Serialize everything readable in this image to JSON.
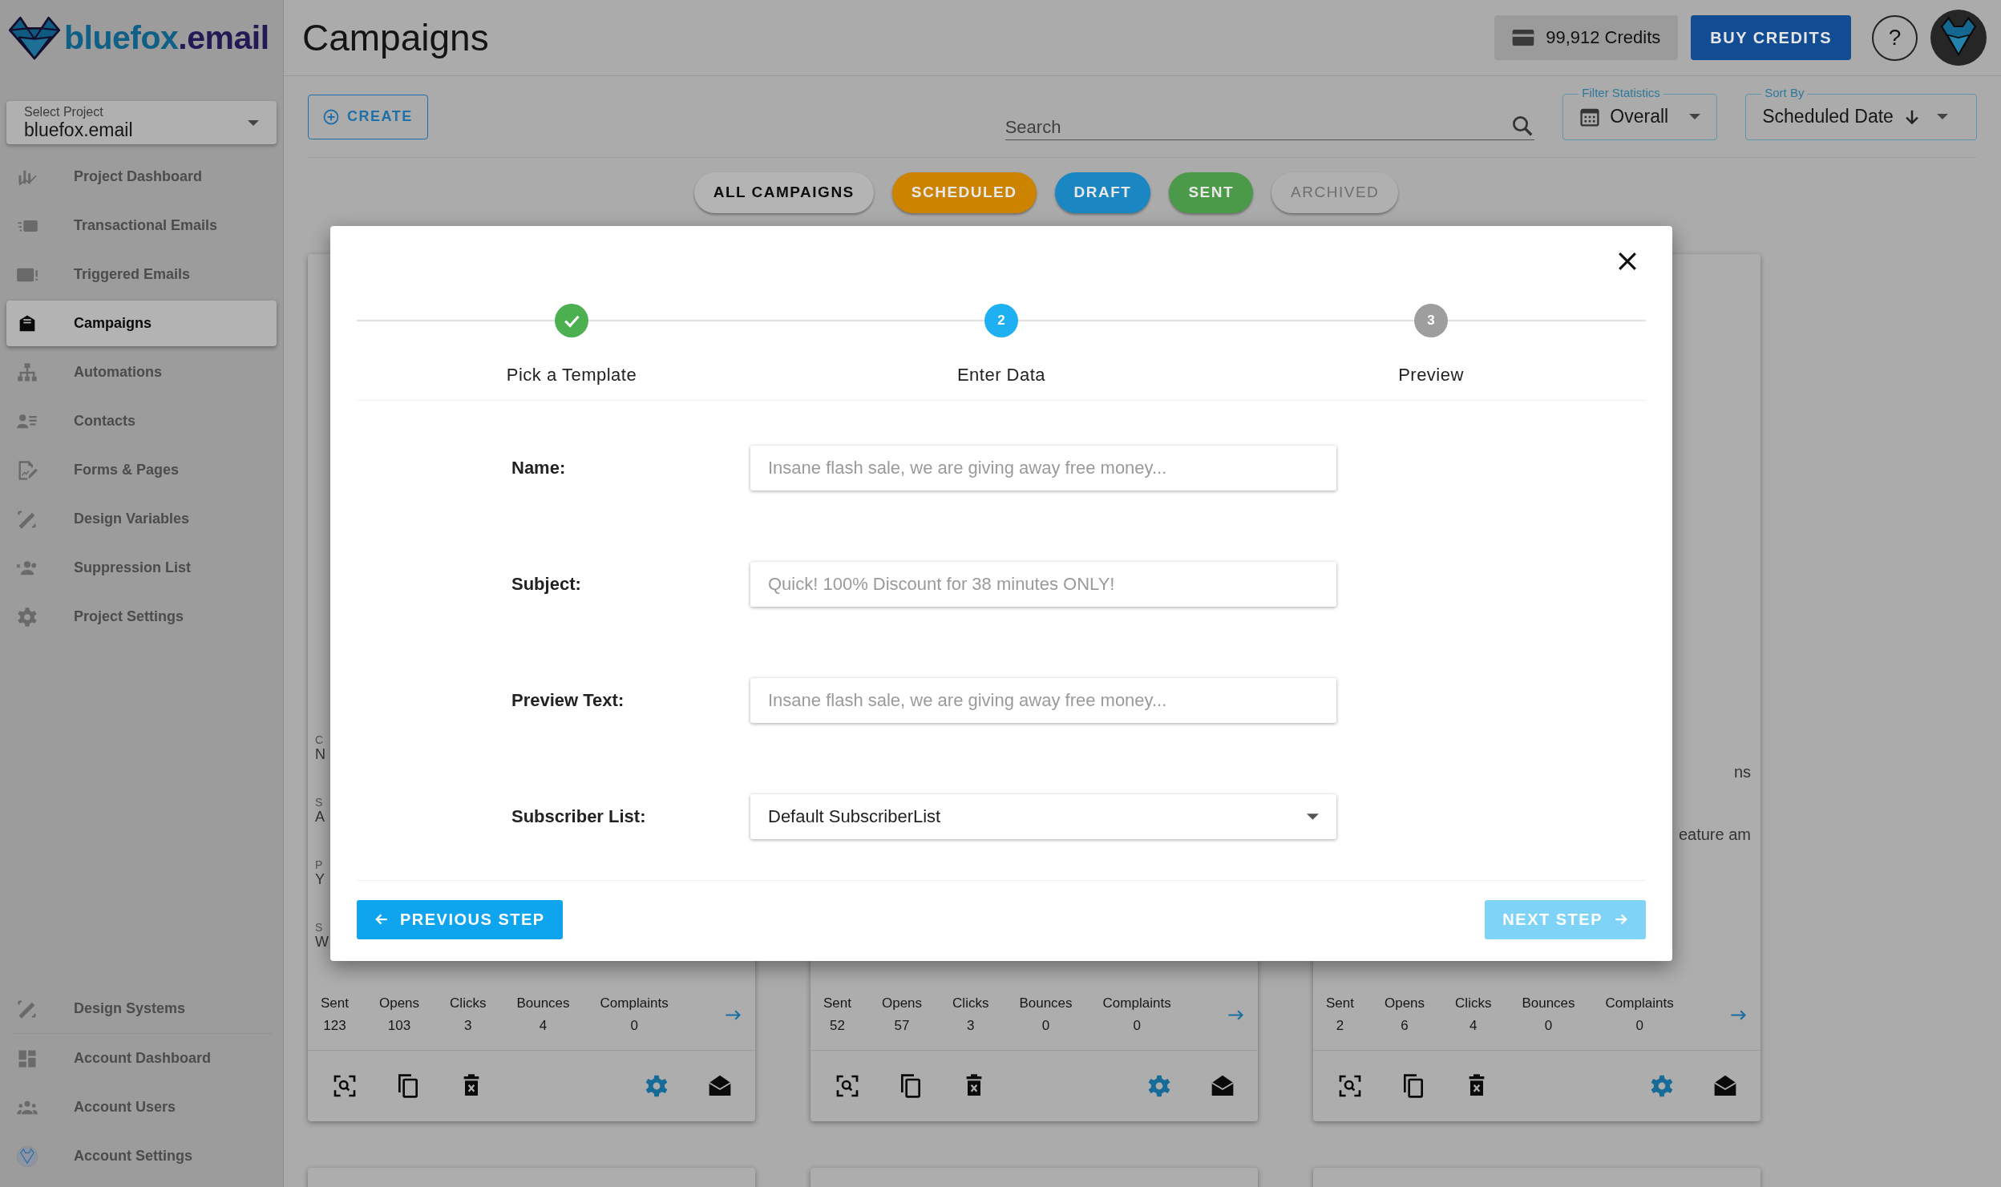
{
  "sidebar": {
    "logo": {
      "main": "bluefox",
      "suffix": ".email"
    },
    "project_select": {
      "label": "Select Project",
      "value": "bluefox.email"
    },
    "items": [
      {
        "label": "Project Dashboard",
        "selected": false
      },
      {
        "label": "Transactional Emails",
        "selected": false
      },
      {
        "label": "Triggered Emails",
        "selected": false
      },
      {
        "label": "Campaigns",
        "selected": true
      },
      {
        "label": "Automations",
        "selected": false
      },
      {
        "label": "Contacts",
        "selected": false
      },
      {
        "label": "Forms & Pages",
        "selected": false
      },
      {
        "label": "Design Variables",
        "selected": false
      },
      {
        "label": "Suppression List",
        "selected": false
      },
      {
        "label": "Project Settings",
        "selected": false
      }
    ],
    "bottom_items": [
      {
        "label": "Design Systems",
        "selected": false
      },
      {
        "label": "Account Dashboard",
        "selected": false
      },
      {
        "label": "Account Users",
        "selected": false
      },
      {
        "label": "Account Settings",
        "selected": false
      }
    ]
  },
  "header": {
    "title": "Campaigns",
    "credits": "99,912 Credits",
    "buy_button": "BUY CREDITS",
    "help": "?"
  },
  "toolbar": {
    "create_button": "CREATE",
    "search": {
      "placeholder": "Search"
    },
    "filter": {
      "label": "Filter Statistics",
      "value": "Overall"
    },
    "sort": {
      "label": "Sort By",
      "value": "Scheduled Date"
    }
  },
  "filters": [
    {
      "label": "ALL CAMPAIGNS",
      "selected": true,
      "disabled": false,
      "color": "#b4b4b4"
    },
    {
      "label": "SCHEDULED",
      "selected": false,
      "disabled": false,
      "color": "#cc8400"
    },
    {
      "label": "DRAFT",
      "selected": false,
      "disabled": false,
      "color": "#1a87c3"
    },
    {
      "label": "SENT",
      "selected": false,
      "disabled": false,
      "color": "#4a9a4a"
    },
    {
      "label": "ARCHIVED",
      "selected": false,
      "disabled": true,
      "color": "#b0b0b0"
    }
  ],
  "cards": [
    {
      "fields": [
        {
          "label": "C",
          "value": "N"
        },
        {
          "label": "S",
          "value": "A"
        },
        {
          "label": "P",
          "value": "Y"
        },
        {
          "label": "S",
          "value": "W"
        }
      ],
      "stats": [
        {
          "label": "Sent",
          "value": "123"
        },
        {
          "label": "Opens",
          "value": "103"
        },
        {
          "label": "Clicks",
          "value": "3"
        },
        {
          "label": "Bounces",
          "value": "4"
        },
        {
          "label": "Complaints",
          "value": "0"
        }
      ]
    },
    {
      "stats": [
        {
          "label": "Sent",
          "value": "52"
        },
        {
          "label": "Opens",
          "value": "57"
        },
        {
          "label": "Clicks",
          "value": "3"
        },
        {
          "label": "Bounces",
          "value": "0"
        },
        {
          "label": "Complaints",
          "value": "0"
        }
      ]
    },
    {
      "fields": [
        {
          "value": "ns"
        },
        {
          "value": "eature am"
        }
      ],
      "stats": [
        {
          "label": "Sent",
          "value": "2"
        },
        {
          "label": "Opens",
          "value": "6"
        },
        {
          "label": "Clicks",
          "value": "4"
        },
        {
          "label": "Bounces",
          "value": "0"
        },
        {
          "label": "Complaints",
          "value": "0"
        }
      ]
    }
  ],
  "modal": {
    "steps": [
      {
        "label": "Pick a Template",
        "done": true,
        "current": false
      },
      {
        "label": "Enter Data",
        "number": "2",
        "done": false,
        "current": true
      },
      {
        "label": "Preview",
        "number": "3",
        "done": false,
        "current": false
      }
    ],
    "fields": [
      {
        "kind": "text",
        "label": "Name:",
        "placeholder": "Insane flash sale, we are giving away free money..."
      },
      {
        "kind": "text",
        "label": "Subject:",
        "placeholder": "Quick! 100% Discount for 38 minutes ONLY!"
      },
      {
        "kind": "text",
        "label": "Preview Text:",
        "placeholder": "Insane flash sale, we are giving away free money..."
      },
      {
        "kind": "select",
        "label": "Subscriber List:",
        "value": "Default SubscriberList"
      }
    ],
    "previous_button": {
      "label": "PREVIOUS STEP",
      "disabled": false
    },
    "next_button": {
      "label": "NEXT STEP",
      "disabled": true
    }
  }
}
